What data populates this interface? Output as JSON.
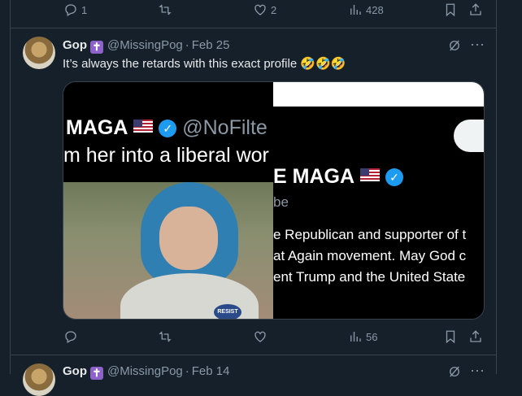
{
  "top_actions": {
    "reply_count": "1",
    "repost_count": "",
    "like_count": "2",
    "view_count": "428"
  },
  "tweet": {
    "name": "Gop",
    "badge": "✝",
    "handle": "@MissingPog",
    "date": "Feb 25",
    "text": "It’s always the retards with this exact profile 🤣🤣🤣",
    "media_left": {
      "line1_name": "MAGA",
      "line1_handle": "@NoFilte",
      "line2": "m her into a liberal wor",
      "pin_text": "RESIST"
    },
    "media_right": {
      "line1_name": "MAGA",
      "line1_prefix": "E",
      "line2": "be",
      "bio1": "e Republican and supporter of t",
      "bio2": "at Again movement. May God c",
      "bio3": "ent Trump and the United State"
    },
    "reply_count": "",
    "repost_count": "",
    "like_count": "",
    "view_count": "56"
  },
  "next_tweet": {
    "name": "Gop",
    "badge": "✝",
    "handle": "@MissingPog",
    "date": "Feb 14"
  },
  "colors": {
    "background": "#15202b",
    "border": "#38444d",
    "muted": "#8b98a5",
    "accent": "#1d9bf0",
    "badge": "#8e63c9"
  }
}
